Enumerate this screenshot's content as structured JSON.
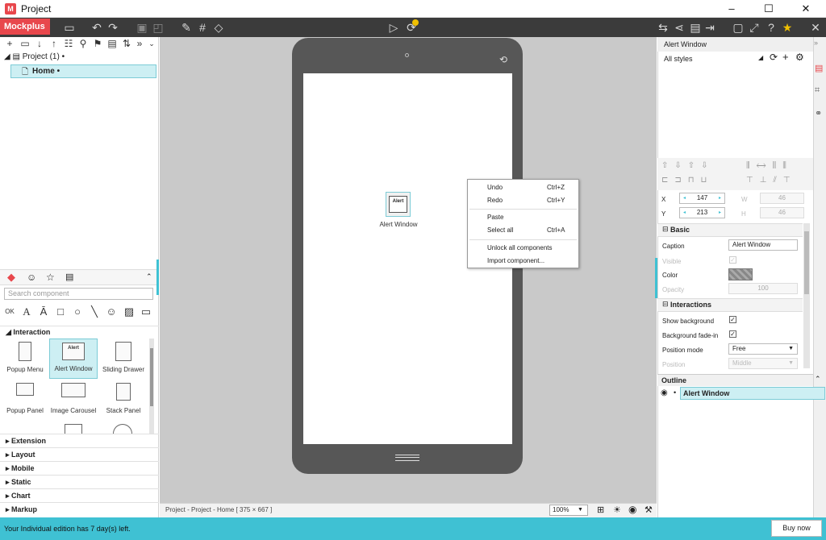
{
  "window": {
    "title": "Project",
    "minimize": "–",
    "maximize": "☐",
    "close": "✕",
    "app_icon": "M"
  },
  "toolbar": {
    "brand": "Mockplus ▾",
    "icons_left": [
      "save-icon",
      "undo-icon",
      "redo-icon",
      "group-icon",
      "ungroup-icon",
      "brush-icon",
      "grid-icon",
      "fill-icon"
    ],
    "icons_center": [
      "play-icon",
      "sync-icon"
    ],
    "icons_right": [
      "export-icon",
      "share-icon",
      "publish-icon",
      "exit-icon",
      "window-icon",
      "fullscreen-icon",
      "help-icon",
      "star-icon"
    ],
    "more_icon": "✕"
  },
  "tree": {
    "project": "Project (1)",
    "home": "Home"
  },
  "component_panel": {
    "search_placeholder": "Search component",
    "category_open": "Interaction",
    "components": [
      {
        "label": "Popup Menu"
      },
      {
        "label": "Alert Window",
        "thumb_text": "Alert"
      },
      {
        "label": "Sliding Drawer"
      },
      {
        "label": "Popup Panel"
      },
      {
        "label": "Image Carousel"
      },
      {
        "label": "Stack Panel"
      }
    ],
    "categories": [
      "Extension",
      "Layout",
      "Mobile",
      "Static",
      "Chart",
      "Markup"
    ]
  },
  "canvas": {
    "widget_thumb": "Alert",
    "widget_caption": "Alert Window",
    "status_path": "Project - Project - Home [ 375 × 667 ]",
    "zoom": "100%"
  },
  "context_menu": {
    "items": [
      {
        "label": "Undo",
        "shortcut": "Ctrl+Z"
      },
      {
        "label": "Redo",
        "shortcut": "Ctrl+Y"
      },
      {
        "label": "Paste",
        "shortcut": ""
      },
      {
        "label": "Select all",
        "shortcut": "Ctrl+A"
      },
      {
        "label": "Unlock all components",
        "shortcut": ""
      },
      {
        "label": "Import component...",
        "shortcut": ""
      }
    ]
  },
  "properties": {
    "title": "Alert Window",
    "styles": "All styles",
    "x_label": "X",
    "x_value": "147",
    "y_label": "Y",
    "y_value": "213",
    "w_label": "W",
    "w_value": "46",
    "h_label": "H",
    "h_value": "46",
    "basic_section": "Basic",
    "caption_label": "Caption",
    "caption_value": "Alert Window",
    "visible_label": "Visible",
    "color_label": "Color",
    "opacity_label": "Opacity",
    "opacity_value": "100",
    "interactions_section": "Interactions",
    "show_bg_label": "Show background",
    "bg_fade_label": "Background fade-in",
    "position_mode_label": "Position mode",
    "position_mode_value": "Free",
    "position_label": "Position",
    "position_value": "Middle"
  },
  "outline": {
    "title": "Outline",
    "item": "Alert Window"
  },
  "footer": {
    "trial_text": "Your Individual edition has 7 day(s) left.",
    "buy": "Buy now"
  },
  "colors": {
    "accent": "#3fc1d3",
    "brand": "#e8474c",
    "toolbar": "#3b3b3b",
    "selection": "#cdeff3"
  }
}
